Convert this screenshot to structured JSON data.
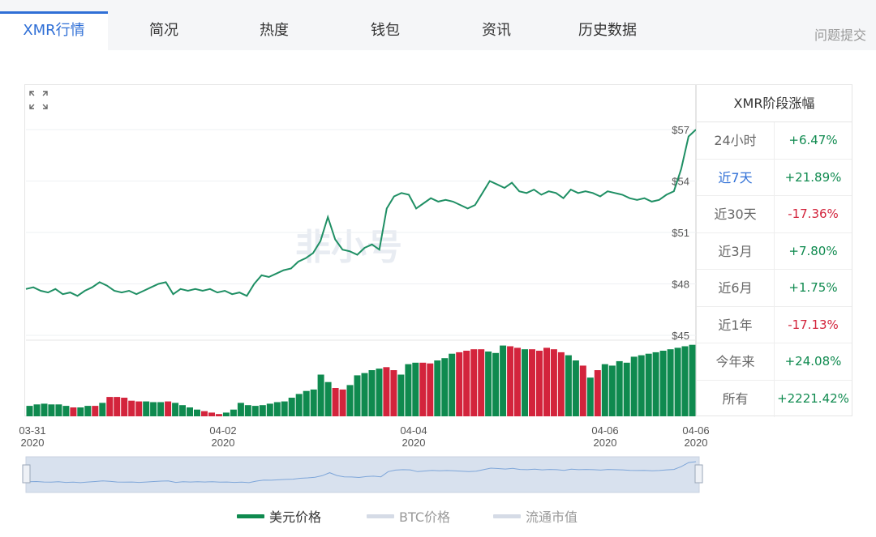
{
  "tabs": [
    {
      "label": "XMR行情",
      "active": true
    },
    {
      "label": "简况",
      "active": false
    },
    {
      "label": "热度",
      "active": false
    },
    {
      "label": "钱包",
      "active": false
    },
    {
      "label": "资讯",
      "active": false
    },
    {
      "label": "历史数据",
      "active": false
    }
  ],
  "feedback_label": "问题提交",
  "watermark": "非小号",
  "stats": {
    "title": "XMR阶段涨幅",
    "rows": [
      {
        "label": "24小时",
        "value": "+6.47%",
        "dir": "up",
        "active": false
      },
      {
        "label": "近7天",
        "value": "+21.89%",
        "dir": "up",
        "active": true
      },
      {
        "label": "近30天",
        "value": "-17.36%",
        "dir": "down",
        "active": false
      },
      {
        "label": "近3月",
        "value": "+7.80%",
        "dir": "up",
        "active": false
      },
      {
        "label": "近6月",
        "value": "+1.75%",
        "dir": "up",
        "active": false
      },
      {
        "label": "近1年",
        "value": "-17.13%",
        "dir": "down",
        "active": false
      },
      {
        "label": "今年来",
        "value": "+24.08%",
        "dir": "up",
        "active": false
      },
      {
        "label": "所有",
        "value": "+2221.42%",
        "dir": "up",
        "active": false
      }
    ]
  },
  "legend": [
    {
      "label": "美元价格",
      "color": "#0f8a4f",
      "active": true
    },
    {
      "label": "BTC价格",
      "color": "#d5dbe6",
      "active": false
    },
    {
      "label": "流通市值",
      "color": "#d5dbe6",
      "active": false
    }
  ],
  "colors": {
    "up": "#0f8a4f",
    "down": "#d3243c",
    "line": "#1f8f64",
    "accent": "#2f6fd6"
  },
  "chart_data": {
    "type": "line",
    "title": "",
    "ylim": [
      45,
      57
    ],
    "y_ticks": [
      "$57",
      "$54",
      "$51",
      "$48",
      "$45"
    ],
    "x_ticks": [
      {
        "date": "03-31",
        "year": "2020"
      },
      {
        "date": "04-02",
        "year": "2020"
      },
      {
        "date": "04-04",
        "year": "2020"
      },
      {
        "date": "04-06",
        "year": "2020"
      },
      {
        "date": "04-06",
        "year": "2020"
      }
    ],
    "price": [
      47.7,
      47.8,
      47.6,
      47.5,
      47.7,
      47.4,
      47.5,
      47.3,
      47.6,
      47.8,
      48.1,
      47.9,
      47.6,
      47.5,
      47.6,
      47.4,
      47.6,
      47.8,
      48.0,
      48.1,
      47.4,
      47.7,
      47.6,
      47.7,
      47.6,
      47.7,
      47.5,
      47.6,
      47.4,
      47.5,
      47.3,
      48.0,
      48.5,
      48.4,
      48.6,
      48.8,
      48.9,
      49.3,
      49.5,
      49.8,
      50.5,
      51.9,
      50.6,
      50.0,
      49.9,
      49.7,
      50.1,
      50.3,
      50.0,
      52.4,
      53.1,
      53.3,
      53.2,
      52.4,
      52.7,
      53.0,
      52.8,
      52.9,
      52.8,
      52.6,
      52.4,
      52.6,
      53.3,
      54.0,
      53.8,
      53.6,
      53.9,
      53.4,
      53.3,
      53.5,
      53.2,
      53.4,
      53.3,
      53.0,
      53.5,
      53.3,
      53.4,
      53.3,
      53.1,
      53.4,
      53.3,
      53.2,
      53.0,
      52.9,
      53.0,
      52.8,
      52.9,
      53.2,
      53.4,
      54.7,
      56.6,
      57.0
    ],
    "volume_dir": [
      "up",
      "up",
      "up",
      "up",
      "up",
      "up",
      "down",
      "up",
      "up",
      "down",
      "up",
      "down",
      "down",
      "down",
      "down",
      "down",
      "up",
      "up",
      "up",
      "down",
      "up",
      "up",
      "up",
      "up",
      "down",
      "down",
      "down",
      "up",
      "up",
      "up",
      "up",
      "up",
      "up",
      "up",
      "up",
      "up",
      "up",
      "up",
      "up",
      "up",
      "up",
      "up",
      "down",
      "down",
      "up",
      "up",
      "up",
      "up",
      "up",
      "down",
      "down",
      "up",
      "up",
      "up",
      "down",
      "down",
      "up",
      "up",
      "up",
      "down",
      "down",
      "down",
      "down",
      "up",
      "up",
      "up",
      "down",
      "down",
      "up",
      "down",
      "down",
      "down",
      "down",
      "down",
      "up",
      "up",
      "down",
      "up",
      "down",
      "up",
      "up",
      "up",
      "up",
      "up",
      "up",
      "up",
      "up",
      "up",
      "up",
      "up",
      "up",
      "up"
    ],
    "volume_level": [
      0.14,
      0.16,
      0.17,
      0.16,
      0.16,
      0.14,
      0.12,
      0.12,
      0.14,
      0.14,
      0.18,
      0.26,
      0.26,
      0.25,
      0.21,
      0.2,
      0.2,
      0.19,
      0.19,
      0.2,
      0.18,
      0.15,
      0.12,
      0.09,
      0.07,
      0.05,
      0.03,
      0.05,
      0.09,
      0.18,
      0.15,
      0.14,
      0.15,
      0.17,
      0.19,
      0.2,
      0.25,
      0.3,
      0.34,
      0.36,
      0.56,
      0.46,
      0.38,
      0.36,
      0.42,
      0.55,
      0.58,
      0.62,
      0.64,
      0.66,
      0.62,
      0.56,
      0.7,
      0.72,
      0.72,
      0.71,
      0.75,
      0.78,
      0.84,
      0.86,
      0.88,
      0.9,
      0.9,
      0.87,
      0.85,
      0.95,
      0.94,
      0.92,
      0.9,
      0.9,
      0.88,
      0.92,
      0.9,
      0.86,
      0.82,
      0.75,
      0.68,
      0.52,
      0.62,
      0.7,
      0.68,
      0.74,
      0.72,
      0.8,
      0.82,
      0.84,
      0.86,
      0.88,
      0.9,
      0.92,
      0.94,
      0.96
    ]
  }
}
